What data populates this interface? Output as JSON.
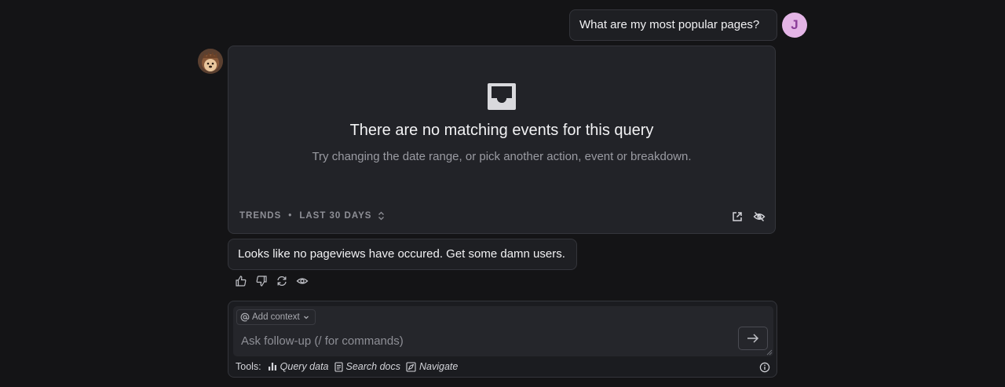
{
  "conversation": {
    "user_message": "What are my most popular pages?",
    "user_initial": "J",
    "visualization": {
      "empty_title": "There are no matching events for this query",
      "empty_subtitle": "Try changing the date range, or pick another action, event or breakdown.",
      "insight_type": "TRENDS",
      "separator": "•",
      "date_range": "LAST 30 DAYS",
      "open_icon": "open-in-new-icon",
      "hide_icon": "eye-off-icon"
    },
    "assistant_message": "Looks like no pageviews have occured. Get some damn users.",
    "feedback_icons": [
      "thumbs-up-icon",
      "thumbs-down-icon",
      "retry-icon",
      "eye-icon"
    ]
  },
  "composer": {
    "add_context_label": "Add context",
    "placeholder": "Ask follow-up (/ for commands)",
    "tools_label": "Tools:",
    "tools": [
      {
        "label": "Query data",
        "icon": "bar-chart-icon"
      },
      {
        "label": "Search docs",
        "icon": "document-icon"
      },
      {
        "label": "Navigate",
        "icon": "compass-icon"
      }
    ]
  },
  "colors": {
    "background": "#141416",
    "card": "#222328",
    "border": "#34353b",
    "user_avatar_bg": "#e4b5e6",
    "user_avatar_fg": "#8a3c98"
  }
}
